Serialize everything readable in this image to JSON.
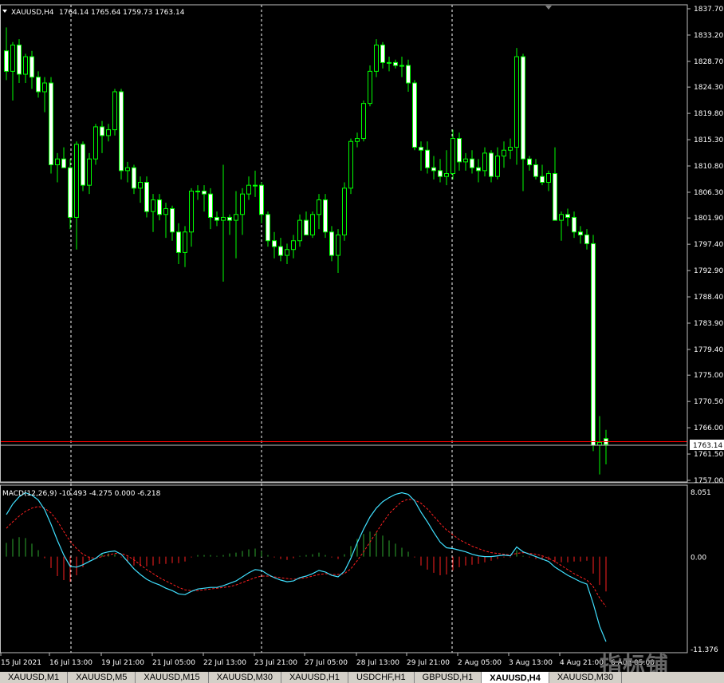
{
  "header": {
    "symbol_label": "XAUUSD,H4",
    "ohlc": "1764.14 1765.64 1759.73 1763.14"
  },
  "macd_header": "MACD(12,26,9) -10.493 -4.275 0.000 -6.218",
  "current_price_label": "1763.14",
  "price_axis_labels": [
    "1837.70",
    "1833.20",
    "1828.70",
    "1824.30",
    "1819.80",
    "1815.30",
    "1810.80",
    "1806.30",
    "1801.90",
    "1797.40",
    "1792.90",
    "1788.40",
    "1783.90",
    "1779.40",
    "1775.00",
    "1770.50",
    "1766.00",
    "1761.50",
    "1757.00"
  ],
  "macd_axis_labels": [
    "8.051",
    "0.00",
    "-11.376"
  ],
  "time_axis_labels": [
    "15 Jul 2021",
    "16 Jul 13:00",
    "19 Jul 21:00",
    "21 Jul 05:00",
    "22 Jul 13:00",
    "23 Jul 21:00",
    "27 Jul 05:00",
    "28 Jul 13:00",
    "29 Jul 21:00",
    "2 Aug 05:00",
    "3 Aug 13:00",
    "4 Aug 21:00",
    "6 Aug 05:00"
  ],
  "tabs": [
    "XAUUSD,M1",
    "XAUUSD,M5",
    "XAUUSD,M15",
    "XAUUSD,M30",
    "XAUUSD,H1",
    "USDCHF,H1",
    "GBPUSD,H1",
    "XAUUSD,H4",
    "XAUUSD,M30"
  ],
  "active_tab_index": 7,
  "watermark": "指标铺",
  "colors": {
    "background": "#000000",
    "bull_candle": "#000000",
    "bear_candle": "#ffffff",
    "wick": "#00ff00",
    "grid": "#ffffff",
    "current_price_line": "#ff0000",
    "macd_line": "#40e0ff",
    "signal_line": "#ff2020",
    "hist_positive": "#2ea82e",
    "hist_negative": "#ff2020"
  },
  "chart_data": {
    "type": "candlestick",
    "symbol": "XAUUSD",
    "timeframe": "H4",
    "ylim": [
      1757.0,
      1837.7
    ],
    "last_price": 1763.14,
    "candles": [
      {
        "o": 1830.5,
        "h": 1834.5,
        "l": 1825.5,
        "c": 1827.0
      },
      {
        "o": 1827.0,
        "h": 1832.0,
        "l": 1822.0,
        "c": 1831.5
      },
      {
        "o": 1831.5,
        "h": 1832.5,
        "l": 1825.0,
        "c": 1826.5
      },
      {
        "o": 1826.5,
        "h": 1830.0,
        "l": 1825.0,
        "c": 1829.5
      },
      {
        "o": 1829.5,
        "h": 1830.5,
        "l": 1824.0,
        "c": 1826.0
      },
      {
        "o": 1826.0,
        "h": 1827.0,
        "l": 1822.5,
        "c": 1823.5
      },
      {
        "o": 1823.5,
        "h": 1826.0,
        "l": 1820.0,
        "c": 1825.0
      },
      {
        "o": 1825.0,
        "h": 1826.0,
        "l": 1809.5,
        "c": 1811.0
      },
      {
        "o": 1811.0,
        "h": 1813.0,
        "l": 1808.0,
        "c": 1812.0
      },
      {
        "o": 1812.0,
        "h": 1814.0,
        "l": 1810.5,
        "c": 1810.5
      },
      {
        "o": 1810.5,
        "h": 1812.0,
        "l": 1800.0,
        "c": 1802.0
      },
      {
        "o": 1802.0,
        "h": 1815.0,
        "l": 1796.5,
        "c": 1814.5
      },
      {
        "o": 1814.5,
        "h": 1815.0,
        "l": 1806.5,
        "c": 1807.5
      },
      {
        "o": 1807.5,
        "h": 1813.0,
        "l": 1806.0,
        "c": 1812.0
      },
      {
        "o": 1812.0,
        "h": 1818.0,
        "l": 1811.0,
        "c": 1817.5
      },
      {
        "o": 1817.5,
        "h": 1818.5,
        "l": 1813.0,
        "c": 1816.0
      },
      {
        "o": 1816.0,
        "h": 1818.0,
        "l": 1815.0,
        "c": 1817.0
      },
      {
        "o": 1817.0,
        "h": 1824.0,
        "l": 1816.0,
        "c": 1823.5
      },
      {
        "o": 1823.5,
        "h": 1824.0,
        "l": 1808.5,
        "c": 1810.0
      },
      {
        "o": 1810.0,
        "h": 1811.5,
        "l": 1808.0,
        "c": 1810.5
      },
      {
        "o": 1810.5,
        "h": 1811.0,
        "l": 1806.0,
        "c": 1807.0
      },
      {
        "o": 1807.0,
        "h": 1809.0,
        "l": 1804.5,
        "c": 1808.0
      },
      {
        "o": 1808.0,
        "h": 1809.0,
        "l": 1802.0,
        "c": 1803.0
      },
      {
        "o": 1803.0,
        "h": 1806.0,
        "l": 1799.5,
        "c": 1805.0
      },
      {
        "o": 1805.0,
        "h": 1806.0,
        "l": 1801.5,
        "c": 1802.5
      },
      {
        "o": 1802.5,
        "h": 1804.5,
        "l": 1798.5,
        "c": 1803.5
      },
      {
        "o": 1803.5,
        "h": 1804.0,
        "l": 1798.0,
        "c": 1799.5
      },
      {
        "o": 1799.5,
        "h": 1801.0,
        "l": 1794.0,
        "c": 1796.0
      },
      {
        "o": 1796.0,
        "h": 1800.5,
        "l": 1793.5,
        "c": 1799.5
      },
      {
        "o": 1799.5,
        "h": 1807.0,
        "l": 1797.0,
        "c": 1806.5
      },
      {
        "o": 1806.5,
        "h": 1807.5,
        "l": 1805.0,
        "c": 1806.5
      },
      {
        "o": 1806.5,
        "h": 1807.5,
        "l": 1803.0,
        "c": 1806.0
      },
      {
        "o": 1806.0,
        "h": 1807.0,
        "l": 1800.0,
        "c": 1802.0
      },
      {
        "o": 1802.0,
        "h": 1803.0,
        "l": 1800.5,
        "c": 1801.5
      },
      {
        "o": 1801.5,
        "h": 1811.0,
        "l": 1791.0,
        "c": 1802.0
      },
      {
        "o": 1802.0,
        "h": 1802.5,
        "l": 1799.0,
        "c": 1801.5
      },
      {
        "o": 1801.5,
        "h": 1806.5,
        "l": 1795.0,
        "c": 1802.5
      },
      {
        "o": 1802.5,
        "h": 1807.0,
        "l": 1799.0,
        "c": 1806.0
      },
      {
        "o": 1806.0,
        "h": 1809.0,
        "l": 1805.0,
        "c": 1807.5
      },
      {
        "o": 1807.5,
        "h": 1810.0,
        "l": 1805.5,
        "c": 1807.5
      },
      {
        "o": 1807.5,
        "h": 1808.0,
        "l": 1801.0,
        "c": 1802.5
      },
      {
        "o": 1802.5,
        "h": 1803.0,
        "l": 1797.0,
        "c": 1798.0
      },
      {
        "o": 1798.0,
        "h": 1799.5,
        "l": 1795.0,
        "c": 1797.0
      },
      {
        "o": 1797.0,
        "h": 1798.5,
        "l": 1794.5,
        "c": 1795.5
      },
      {
        "o": 1795.5,
        "h": 1797.5,
        "l": 1794.0,
        "c": 1796.5
      },
      {
        "o": 1796.5,
        "h": 1799.0,
        "l": 1795.0,
        "c": 1798.0
      },
      {
        "o": 1798.0,
        "h": 1802.5,
        "l": 1797.0,
        "c": 1801.5
      },
      {
        "o": 1801.5,
        "h": 1803.0,
        "l": 1799.0,
        "c": 1799.0
      },
      {
        "o": 1799.0,
        "h": 1803.0,
        "l": 1798.5,
        "c": 1802.5
      },
      {
        "o": 1802.5,
        "h": 1806.0,
        "l": 1800.0,
        "c": 1805.0
      },
      {
        "o": 1805.0,
        "h": 1806.0,
        "l": 1798.5,
        "c": 1799.5
      },
      {
        "o": 1799.5,
        "h": 1800.5,
        "l": 1794.5,
        "c": 1795.5
      },
      {
        "o": 1795.5,
        "h": 1800.0,
        "l": 1792.5,
        "c": 1799.0
      },
      {
        "o": 1799.0,
        "h": 1808.0,
        "l": 1798.0,
        "c": 1807.0
      },
      {
        "o": 1807.0,
        "h": 1815.5,
        "l": 1806.0,
        "c": 1815.0
      },
      {
        "o": 1815.0,
        "h": 1816.5,
        "l": 1814.0,
        "c": 1815.5
      },
      {
        "o": 1815.5,
        "h": 1822.0,
        "l": 1815.0,
        "c": 1821.5
      },
      {
        "o": 1821.5,
        "h": 1828.0,
        "l": 1821.0,
        "c": 1827.0
      },
      {
        "o": 1827.0,
        "h": 1832.5,
        "l": 1826.0,
        "c": 1831.5
      },
      {
        "o": 1831.5,
        "h": 1832.0,
        "l": 1827.5,
        "c": 1828.5
      },
      {
        "o": 1828.5,
        "h": 1829.5,
        "l": 1827.0,
        "c": 1828.5
      },
      {
        "o": 1828.5,
        "h": 1829.0,
        "l": 1827.5,
        "c": 1828.0
      },
      {
        "o": 1828.0,
        "h": 1829.5,
        "l": 1826.0,
        "c": 1828.0
      },
      {
        "o": 1828.0,
        "h": 1829.0,
        "l": 1823.5,
        "c": 1825.0
      },
      {
        "o": 1825.0,
        "h": 1825.5,
        "l": 1813.5,
        "c": 1814.0
      },
      {
        "o": 1814.0,
        "h": 1815.0,
        "l": 1810.0,
        "c": 1813.5
      },
      {
        "o": 1813.5,
        "h": 1815.0,
        "l": 1809.5,
        "c": 1810.5
      },
      {
        "o": 1810.5,
        "h": 1812.5,
        "l": 1808.5,
        "c": 1810.0
      },
      {
        "o": 1810.0,
        "h": 1812.0,
        "l": 1808.0,
        "c": 1809.0
      },
      {
        "o": 1809.0,
        "h": 1813.5,
        "l": 1807.5,
        "c": 1809.5
      },
      {
        "o": 1809.5,
        "h": 1817.0,
        "l": 1808.5,
        "c": 1815.5
      },
      {
        "o": 1815.5,
        "h": 1816.5,
        "l": 1810.0,
        "c": 1811.5
      },
      {
        "o": 1811.5,
        "h": 1813.0,
        "l": 1810.0,
        "c": 1812.0
      },
      {
        "o": 1812.0,
        "h": 1813.5,
        "l": 1809.5,
        "c": 1810.5
      },
      {
        "o": 1810.5,
        "h": 1812.0,
        "l": 1808.0,
        "c": 1810.0
      },
      {
        "o": 1810.0,
        "h": 1814.0,
        "l": 1809.0,
        "c": 1813.0
      },
      {
        "o": 1813.0,
        "h": 1813.5,
        "l": 1808.0,
        "c": 1809.0
      },
      {
        "o": 1809.0,
        "h": 1814.0,
        "l": 1808.5,
        "c": 1812.5
      },
      {
        "o": 1812.5,
        "h": 1815.0,
        "l": 1810.5,
        "c": 1813.5
      },
      {
        "o": 1813.5,
        "h": 1815.5,
        "l": 1812.0,
        "c": 1814.0
      },
      {
        "o": 1814.0,
        "h": 1831.0,
        "l": 1811.0,
        "c": 1829.5
      },
      {
        "o": 1829.5,
        "h": 1830.0,
        "l": 1806.5,
        "c": 1812.0
      },
      {
        "o": 1812.0,
        "h": 1812.5,
        "l": 1810.0,
        "c": 1811.0
      },
      {
        "o": 1811.0,
        "h": 1812.0,
        "l": 1808.5,
        "c": 1809.0
      },
      {
        "o": 1809.0,
        "h": 1811.0,
        "l": 1807.5,
        "c": 1808.0
      },
      {
        "o": 1808.0,
        "h": 1810.0,
        "l": 1806.5,
        "c": 1809.5
      },
      {
        "o": 1809.5,
        "h": 1814.0,
        "l": 1806.0,
        "c": 1801.5
      },
      {
        "o": 1801.5,
        "h": 1803.0,
        "l": 1798.0,
        "c": 1802.5
      },
      {
        "o": 1802.5,
        "h": 1803.5,
        "l": 1800.5,
        "c": 1802.0
      },
      {
        "o": 1802.0,
        "h": 1803.0,
        "l": 1798.5,
        "c": 1799.5
      },
      {
        "o": 1799.5,
        "h": 1800.5,
        "l": 1797.5,
        "c": 1799.0
      },
      {
        "o": 1799.0,
        "h": 1800.0,
        "l": 1796.5,
        "c": 1797.5
      },
      {
        "o": 1797.5,
        "h": 1799.0,
        "l": 1762.0,
        "c": 1763.0
      },
      {
        "o": 1763.0,
        "h": 1768.0,
        "l": 1758.0,
        "c": 1763.5
      },
      {
        "o": 1764.14,
        "h": 1765.64,
        "l": 1759.73,
        "c": 1763.14
      }
    ],
    "macd": {
      "name": "MACD(12,26,9)",
      "ylim": [
        -11.376,
        8.051
      ],
      "macd_line": [
        5.2,
        6.5,
        7.4,
        7.9,
        7.6,
        7.0,
        5.8,
        4.0,
        2.0,
        0.2,
        -1.2,
        -1.3,
        -1.0,
        -0.6,
        -0.2,
        0.4,
        0.6,
        0.7,
        0.3,
        -0.6,
        -1.5,
        -2.2,
        -2.8,
        -3.2,
        -3.5,
        -3.9,
        -4.2,
        -4.6,
        -4.7,
        -4.3,
        -4.0,
        -3.9,
        -3.8,
        -3.8,
        -3.6,
        -3.3,
        -3.0,
        -2.5,
        -2.0,
        -1.6,
        -1.7,
        -2.2,
        -2.6,
        -2.9,
        -3.1,
        -3.0,
        -2.6,
        -2.4,
        -2.1,
        -1.7,
        -1.9,
        -2.3,
        -2.5,
        -1.8,
        -0.2,
        1.7,
        3.4,
        4.9,
        6.0,
        6.8,
        7.3,
        7.7,
        7.9,
        7.7,
        6.9,
        5.5,
        4.3,
        3.0,
        1.8,
        1.1,
        1.0,
        0.8,
        0.6,
        0.3,
        0.1,
        0.0,
        0.0,
        0.1,
        0.2,
        0.1,
        1.2,
        0.6,
        0.3,
        0.0,
        -0.3,
        -0.6,
        -1.3,
        -1.8,
        -2.3,
        -2.7,
        -3.1,
        -3.4,
        -5.8,
        -8.6,
        -10.5
      ],
      "signal_line": [
        3.5,
        4.3,
        5.0,
        5.6,
        6.0,
        6.2,
        6.0,
        5.4,
        4.4,
        3.1,
        1.9,
        1.0,
        0.3,
        -0.1,
        -0.2,
        0.0,
        0.2,
        0.4,
        0.4,
        0.1,
        -0.4,
        -1.0,
        -1.6,
        -2.1,
        -2.6,
        -3.0,
        -3.4,
        -3.8,
        -4.1,
        -4.2,
        -4.2,
        -4.1,
        -4.0,
        -3.9,
        -3.8,
        -3.7,
        -3.5,
        -3.2,
        -2.9,
        -2.6,
        -2.4,
        -2.4,
        -2.5,
        -2.6,
        -2.7,
        -2.8,
        -2.7,
        -2.6,
        -2.4,
        -2.2,
        -2.1,
        -2.2,
        -2.2,
        -2.1,
        -1.5,
        -0.5,
        0.6,
        1.8,
        3.0,
        4.2,
        5.3,
        6.1,
        6.8,
        7.1,
        7.0,
        6.6,
        5.9,
        5.0,
        4.1,
        3.3,
        2.7,
        2.1,
        1.7,
        1.3,
        1.0,
        0.7,
        0.5,
        0.4,
        0.3,
        0.2,
        0.4,
        0.5,
        0.4,
        0.3,
        0.1,
        -0.2,
        -0.6,
        -1.1,
        -1.6,
        -2.1,
        -2.5,
        -2.9,
        -3.7,
        -5.1,
        -6.2
      ]
    },
    "time_labels": [
      "15 Jul 2021",
      "16 Jul 13:00",
      "19 Jul 21:00",
      "21 Jul 05:00",
      "22 Jul 13:00",
      "23 Jul 21:00",
      "27 Jul 05:00",
      "28 Jul 13:00",
      "29 Jul 21:00",
      "2 Aug 05:00",
      "3 Aug 13:00",
      "4 Aug 21:00",
      "6 Aug 05:00"
    ]
  }
}
